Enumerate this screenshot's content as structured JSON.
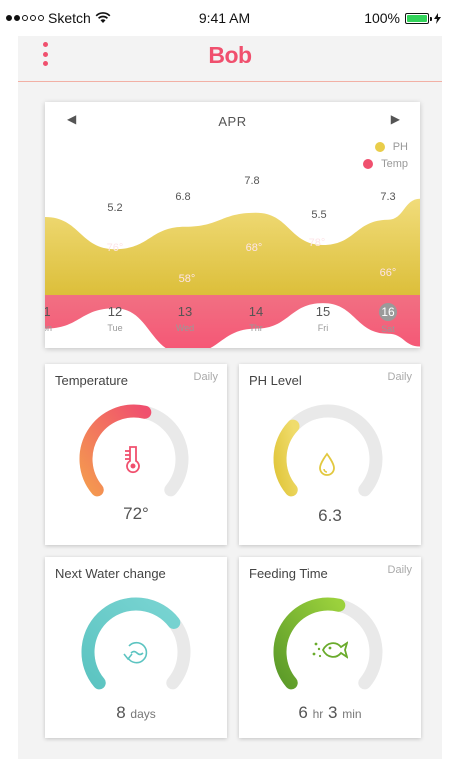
{
  "status_bar": {
    "carrier": "Sketch",
    "time": "9:41 AM",
    "battery": "100%"
  },
  "header": {
    "logo": "Bob",
    "menu_icon": "more-vertical-icon"
  },
  "chart": {
    "month": "APR",
    "prev_icon": "triangle-left-icon",
    "next_icon": "triangle-right-icon",
    "legend": [
      {
        "label": "PH",
        "color": "#e9cd4a"
      },
      {
        "label": "Temp",
        "color": "#f0506e"
      }
    ],
    "ph_labels": [
      "5.2",
      "6.8",
      "7.8",
      "5.5",
      "7.3"
    ],
    "temp_labels": [
      "76°",
      "58°",
      "68°",
      "78°",
      "66°"
    ],
    "days": [
      {
        "num": "1",
        "name": "on"
      },
      {
        "num": "12",
        "name": "Tue"
      },
      {
        "num": "13",
        "name": "Wed"
      },
      {
        "num": "14",
        "name": "Thr"
      },
      {
        "num": "15",
        "name": "Fri"
      },
      {
        "num": "16",
        "name": "Sat"
      }
    ]
  },
  "chart_data": {
    "type": "area",
    "title": "APR",
    "categories": [
      "12",
      "13",
      "14",
      "15",
      "16"
    ],
    "series": [
      {
        "name": "PH",
        "values": [
          5.2,
          6.8,
          7.8,
          5.5,
          7.3
        ],
        "color": "#e9cd4a"
      },
      {
        "name": "Temp",
        "values": [
          76,
          58,
          68,
          78,
          66
        ],
        "color": "#f0506e"
      }
    ],
    "legend": "top-right",
    "grid": false
  },
  "cards": {
    "temperature": {
      "title": "Temperature",
      "tag": "Daily",
      "value": "72°",
      "level": 0.55,
      "color_start": "#f49a4f",
      "color_end": "#f0506e",
      "icon": "thermometer-icon"
    },
    "ph": {
      "title": "PH Level",
      "tag": "Daily",
      "value": "6.3",
      "level": 0.32,
      "color_start": "#e2c83f",
      "color_end": "#f0dc6c",
      "icon": "water-drop-icon"
    },
    "water": {
      "title": "Next Water change",
      "value_num": "8",
      "value_unit": "days",
      "level": 0.7,
      "color_start": "#5cc4c1",
      "color_end": "#79d4d2",
      "icon": "water-cycle-icon"
    },
    "feeding": {
      "title": "Feeding Time",
      "tag": "Daily",
      "value_h": "6",
      "unit_h": "hr",
      "value_m": "3",
      "unit_m": "min",
      "level": 0.55,
      "color_start": "#5b9a29",
      "color_end": "#9bd13c",
      "icon": "fish-icon"
    }
  }
}
